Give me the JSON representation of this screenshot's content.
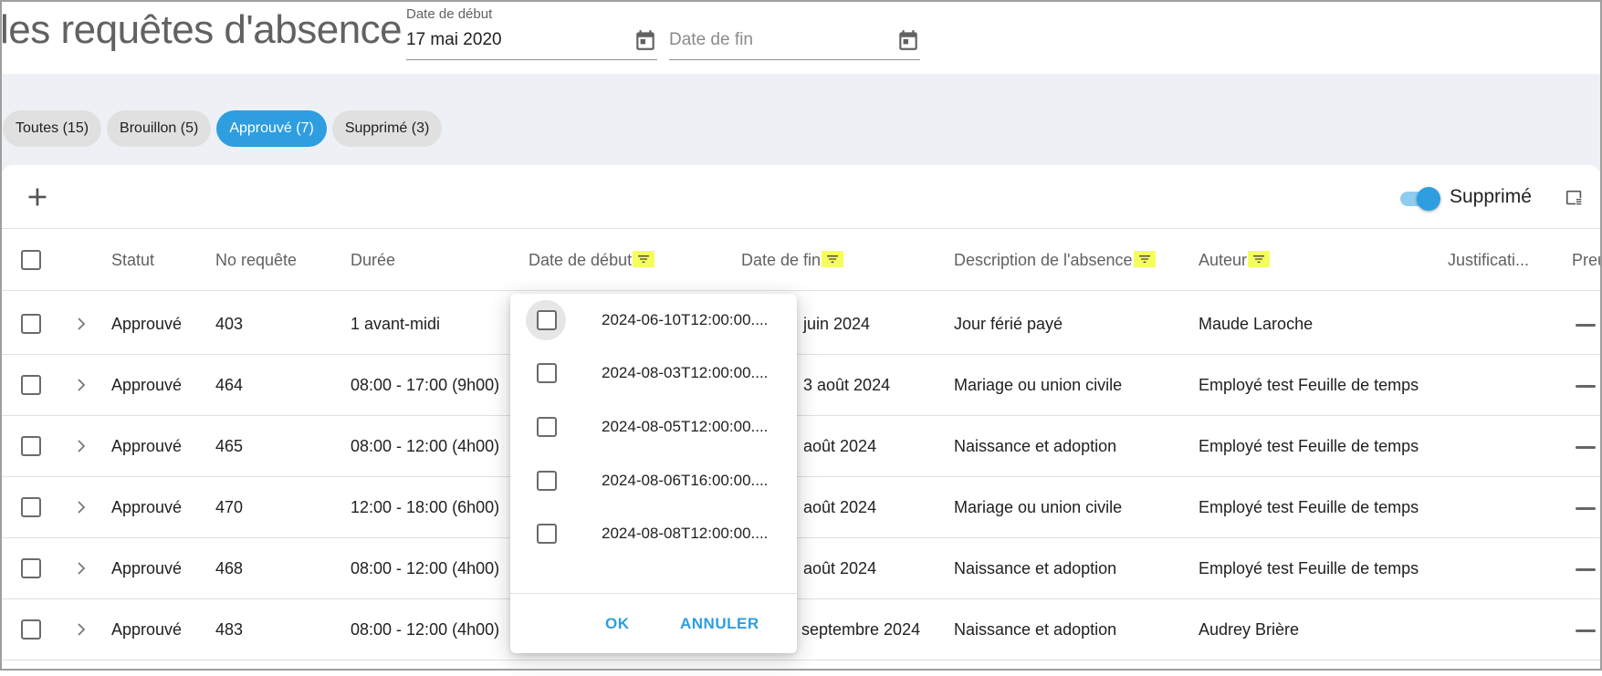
{
  "header": {
    "title": "les requêtes d'absence",
    "start_date": {
      "label": "Date de début",
      "value": "17 mai 2020"
    },
    "end_date": {
      "placeholder": "Date de fin"
    }
  },
  "chips": [
    {
      "label": "Toutes (15)",
      "active": false
    },
    {
      "label": "Brouillon (5)",
      "active": false
    },
    {
      "label": "Approuvé (7)",
      "active": true
    },
    {
      "label": "Supprimé (3)",
      "active": false
    }
  ],
  "toolbar": {
    "toggle_label": "Supprimé",
    "toggle_on": true
  },
  "table": {
    "headers": {
      "statut": "Statut",
      "no_requete": "No requête",
      "duree": "Durée",
      "date_debut": "Date de début",
      "date_fin": "Date de fin",
      "description": "Description de l'absence",
      "auteur": "Auteur",
      "justification": "Justificati...",
      "preuve": "Preu"
    },
    "rows": [
      {
        "statut": "Approuvé",
        "no": "403",
        "duree": "1 avant-midi",
        "date_fin": "juin 2024",
        "description": "Jour férié payé",
        "auteur": "Maude Laroche"
      },
      {
        "statut": "Approuvé",
        "no": "464",
        "duree": "08:00 - 17:00 (9h00)",
        "date_fin": "3 août 2024",
        "description": "Mariage ou union civile",
        "auteur": "Employé test Feuille de temps"
      },
      {
        "statut": "Approuvé",
        "no": "465",
        "duree": "08:00 - 12:00 (4h00)",
        "date_fin": "août 2024",
        "description": "Naissance et adoption",
        "auteur": "Employé test Feuille de temps"
      },
      {
        "statut": "Approuvé",
        "no": "470",
        "duree": "12:00 - 18:00 (6h00)",
        "date_fin": "août 2024",
        "description": "Mariage ou union civile",
        "auteur": "Employé test Feuille de temps"
      },
      {
        "statut": "Approuvé",
        "no": "468",
        "duree": "08:00 - 12:00 (4h00)",
        "date_fin": "août 2024",
        "description": "Naissance et adoption",
        "auteur": "Employé test Feuille de temps"
      },
      {
        "statut": "Approuvé",
        "no": "483",
        "duree": "08:00 - 12:00 (4h00)",
        "date_fin": "septembre 2024",
        "description": "Naissance et adoption",
        "auteur": "Audrey Brière"
      }
    ]
  },
  "filter_popup": {
    "options": [
      "2024-06-10T12:00:00....",
      "2024-08-03T12:00:00....",
      "2024-08-05T12:00:00....",
      "2024-08-06T16:00:00....",
      "2024-08-08T12:00:00...."
    ],
    "ok_label": "OK",
    "cancel_label": "ANNULER"
  },
  "colors": {
    "accent": "#2e9ee0",
    "filter_highlight": "#f5ff5c",
    "filter_bg": "#edf1f5"
  },
  "icons": [
    "calendar-icon",
    "add-icon",
    "columns-icon",
    "filter-icon",
    "chevron-right-icon"
  ]
}
